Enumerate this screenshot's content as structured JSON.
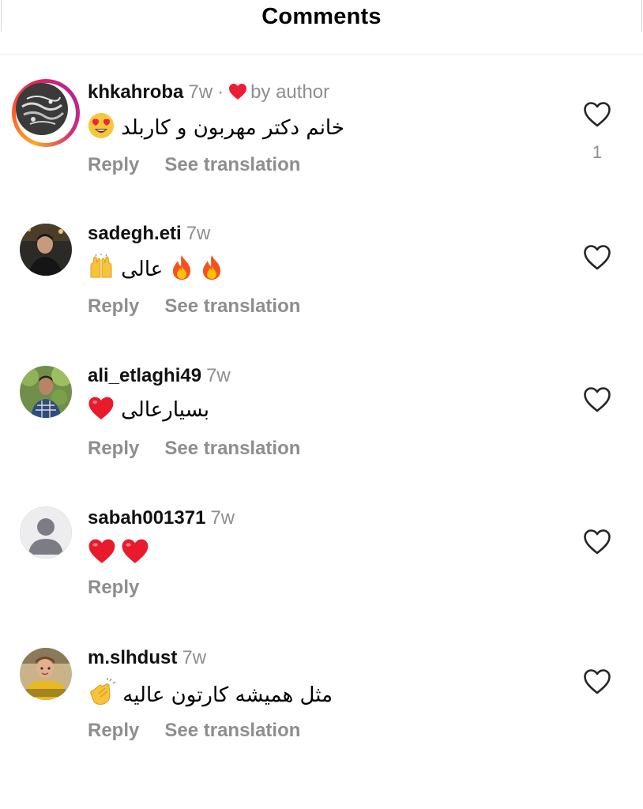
{
  "header": {
    "title": "Comments"
  },
  "comments": [
    {
      "username": "khkahroba",
      "time": "7w",
      "separator": "·",
      "liked_by_author_label": "by author",
      "text": "خانم دکتر مهربون و کاربلد",
      "reply_label": "Reply",
      "translate_label": "See translation",
      "like_count": "1"
    },
    {
      "username": "sadegh.eti",
      "time": "7w",
      "text": "عالی",
      "reply_label": "Reply",
      "translate_label": "See translation"
    },
    {
      "username": "ali_etlaghi49",
      "time": "7w",
      "text": "بسیارعالی",
      "reply_label": "Reply",
      "translate_label": "See translation"
    },
    {
      "username": "sabah001371",
      "time": "7w",
      "reply_label": "Reply"
    },
    {
      "username": "m.slhdust",
      "time": "7w",
      "text": "مثل همیشه کارتون عالیه",
      "reply_label": "Reply",
      "translate_label": "See translation"
    }
  ],
  "icons": {
    "like": "heart-outline-icon",
    "author_like": "heart-filled-icon",
    "default_avatar": "person-silhouette-icon"
  },
  "colors": {
    "author_heart": "#ee1d36",
    "secondary_text": "#8e8e8e",
    "primary_text": "#111111"
  }
}
